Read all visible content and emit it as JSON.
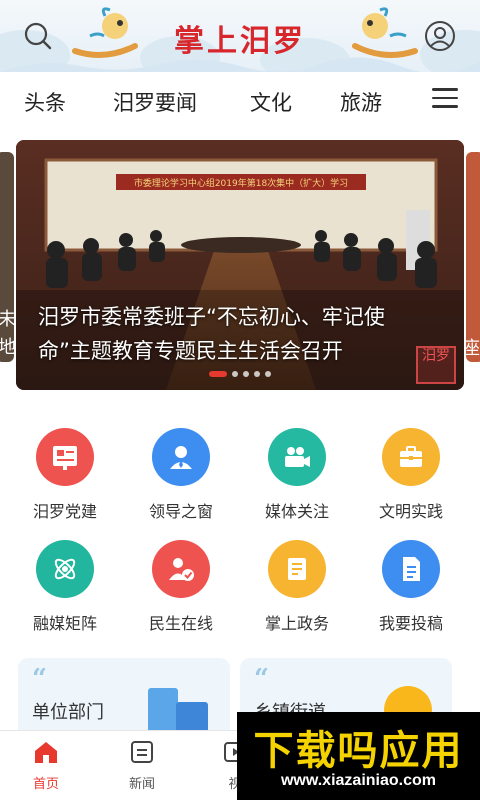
{
  "header": {
    "logo_text": "掌上汨罗",
    "search_icon": "search-icon",
    "user_icon": "user-icon",
    "colors": {
      "logo": "#d7262c",
      "background": "#e7f0f7"
    }
  },
  "tabs": [
    {
      "label": "头条"
    },
    {
      "label": "汨罗要闻"
    },
    {
      "label": "文化"
    },
    {
      "label": "旅游"
    }
  ],
  "menu_icon": "menu-icon",
  "banner": {
    "title": "汨罗市委常委班子“不忘初心、牢记使命”主题教育专题民主生活会召开",
    "scene_caption": "市委理论学习中心组2019年第18次集中（扩大）学习",
    "stamp_text": "汨罗",
    "left_peek_text": "未\n地",
    "right_peek_text": "座",
    "slide_count": 5,
    "active_slide": 1
  },
  "grid": [
    {
      "label": "汨罗党建",
      "icon": "party-flag-icon",
      "color": "#ef5350"
    },
    {
      "label": "领导之窗",
      "icon": "leader-icon",
      "color": "#3d8ef0"
    },
    {
      "label": "媒体关注",
      "icon": "video-camera-icon",
      "color": "#26b9a1"
    },
    {
      "label": "文明实践",
      "icon": "briefcase-icon",
      "color": "#f6b431"
    },
    {
      "label": "融媒矩阵",
      "icon": "atom-icon",
      "color": "#22b69e"
    },
    {
      "label": "民生在线",
      "icon": "user-check-icon",
      "color": "#ef5350"
    },
    {
      "label": "掌上政务",
      "icon": "document-icon",
      "color": "#f6b431"
    },
    {
      "label": "我要投稿",
      "icon": "file-edit-icon",
      "color": "#3d8ef0"
    }
  ],
  "cards": [
    {
      "title": "单位部门",
      "icon": "building-icon"
    },
    {
      "title": "乡镇街道",
      "icon": "sun-icon"
    }
  ],
  "bottom_nav": [
    {
      "label": "首页",
      "icon": "home-icon",
      "active": true
    },
    {
      "label": "新闻",
      "icon": "news-icon",
      "active": false
    },
    {
      "label": "视",
      "icon": "video-icon",
      "active": false
    }
  ],
  "watermark": {
    "title": "下载吗应用",
    "url": "www.xiazainiao.com"
  }
}
